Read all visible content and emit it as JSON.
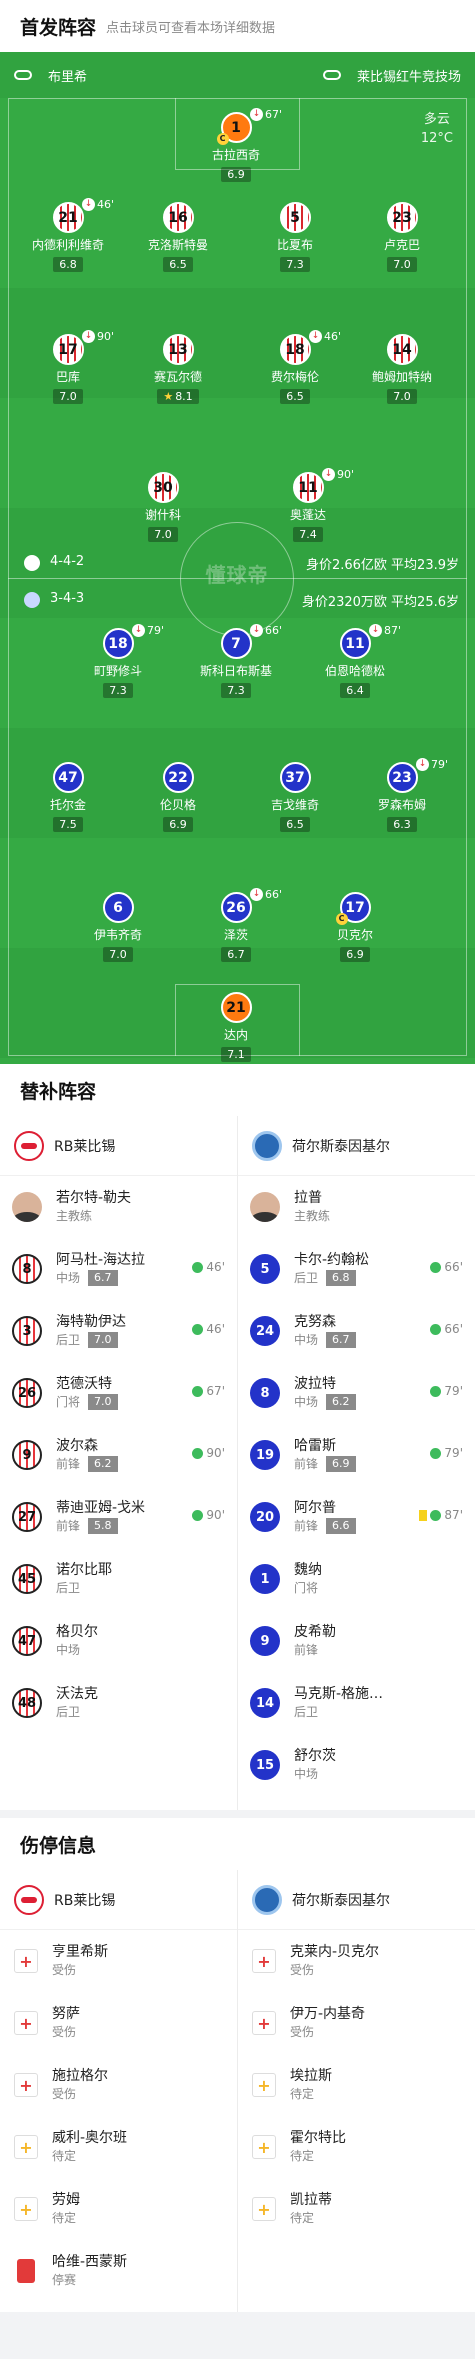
{
  "lineup_section": {
    "title": "首发阵容",
    "subtitle": "点击球员可查看本场详细数据"
  },
  "pitch": {
    "home_team": "布里希",
    "away_team": "莱比锡红牛竞技场",
    "weather": "多云",
    "temperature": "12°C",
    "watermark": "懂球帝",
    "home_formation": "4-4-2",
    "home_stats": "身价2.66亿欧  平均23.9岁",
    "away_formation": "3-4-3",
    "away_stats": "身价2320万欧  平均25.6岁"
  },
  "home_players": [
    {
      "num": "1",
      "name": "古拉西奇",
      "rating": "6.9",
      "sub": "67'",
      "captain": "C"
    },
    {
      "num": "21",
      "name": "内德利利维奇",
      "rating": "6.8",
      "sub": "46'"
    },
    {
      "num": "16",
      "name": "克洛斯特曼",
      "rating": "6.5"
    },
    {
      "num": "5",
      "name": "比夏布",
      "rating": "7.3"
    },
    {
      "num": "23",
      "name": "卢克巴",
      "rating": "7.0"
    },
    {
      "num": "17",
      "name": "巴库",
      "rating": "7.0",
      "sub": "90'"
    },
    {
      "num": "13",
      "name": "赛瓦尔德",
      "rating": "8.1"
    },
    {
      "num": "18",
      "name": "费尔梅伦",
      "rating": "6.5",
      "sub": "46'"
    },
    {
      "num": "14",
      "name": "鲍姆加特纳",
      "rating": "7.0"
    },
    {
      "num": "30",
      "name": "谢什科",
      "rating": "7.0"
    },
    {
      "num": "11",
      "name": "奥蓬达",
      "rating": "7.4",
      "sub": "90'"
    }
  ],
  "away_players": [
    {
      "num": "18",
      "name": "町野修斗",
      "rating": "7.3",
      "sub": "79'"
    },
    {
      "num": "7",
      "name": "斯科日布斯基",
      "rating": "7.3",
      "sub": "66'"
    },
    {
      "num": "11",
      "name": "伯恩哈德松",
      "rating": "6.4",
      "sub": "87'"
    },
    {
      "num": "47",
      "name": "托尔金",
      "rating": "7.5"
    },
    {
      "num": "22",
      "name": "伦贝格",
      "rating": "6.9"
    },
    {
      "num": "37",
      "name": "吉戈维奇",
      "rating": "6.5"
    },
    {
      "num": "23",
      "name": "罗森布姆",
      "rating": "6.3",
      "sub": "79'"
    },
    {
      "num": "6",
      "name": "伊韦齐奇",
      "rating": "7.0"
    },
    {
      "num": "26",
      "name": "泽茨",
      "rating": "6.7",
      "sub": "66'"
    },
    {
      "num": "17",
      "name": "贝克尔",
      "rating": "6.9",
      "captain": "C"
    },
    {
      "num": "21",
      "name": "达内",
      "rating": "7.1"
    }
  ],
  "bench_section": {
    "title": "替补阵容",
    "home_team": "RB莱比锡",
    "away_team": "荷尔斯泰因基尔",
    "home_coach": {
      "name": "若尔特-勒夫",
      "role": "主教练"
    },
    "away_coach": {
      "name": "拉普",
      "role": "主教练"
    },
    "home": [
      {
        "num": "8",
        "name": "阿马杜-海达拉",
        "pos": "中场",
        "rating": "6.7",
        "in": "46'"
      },
      {
        "num": "3",
        "name": "海特勒伊达",
        "pos": "后卫",
        "rating": "7.0",
        "in": "46'"
      },
      {
        "num": "26",
        "name": "范德沃特",
        "pos": "门将",
        "rating": "7.0",
        "in": "67'"
      },
      {
        "num": "9",
        "name": "波尔森",
        "pos": "前锋",
        "rating": "6.2",
        "in": "90'"
      },
      {
        "num": "27",
        "name": "蒂迪亚姆-戈米",
        "pos": "前锋",
        "rating": "5.8",
        "in": "90'"
      },
      {
        "num": "45",
        "name": "诺尔比耶",
        "pos": "后卫"
      },
      {
        "num": "47",
        "name": "格贝尔",
        "pos": "中场"
      },
      {
        "num": "48",
        "name": "沃法克",
        "pos": "后卫"
      }
    ],
    "away": [
      {
        "num": "5",
        "name": "卡尔-约翰松",
        "pos": "后卫",
        "rating": "6.8",
        "in": "66'"
      },
      {
        "num": "24",
        "name": "克努森",
        "pos": "中场",
        "rating": "6.7",
        "in": "66'"
      },
      {
        "num": "8",
        "name": "波拉特",
        "pos": "中场",
        "rating": "6.2",
        "in": "79'"
      },
      {
        "num": "19",
        "name": "哈雷斯",
        "pos": "前锋",
        "rating": "6.9",
        "in": "79'"
      },
      {
        "num": "20",
        "name": "阿尔普",
        "pos": "前锋",
        "rating": "6.6",
        "in": "87'",
        "card": true
      },
      {
        "num": "1",
        "name": "魏纳",
        "pos": "门将"
      },
      {
        "num": "9",
        "name": "皮希勒",
        "pos": "前锋"
      },
      {
        "num": "14",
        "name": "马克斯-格施…",
        "pos": "后卫"
      },
      {
        "num": "15",
        "name": "舒尔茨",
        "pos": "中场"
      }
    ]
  },
  "injury_section": {
    "title": "伤停信息",
    "home_team": "RB莱比锡",
    "away_team": "荷尔斯泰因基尔",
    "home": [
      {
        "name": "亨里希斯",
        "status": "受伤",
        "icon": "injury-red"
      },
      {
        "name": "努萨",
        "status": "受伤",
        "icon": "injury-red"
      },
      {
        "name": "施拉格尔",
        "status": "受伤",
        "icon": "injury-red"
      },
      {
        "name": "威利-奥尔班",
        "status": "待定",
        "icon": "injury-yellow"
      },
      {
        "name": "劳姆",
        "status": "待定",
        "icon": "injury-yellow"
      },
      {
        "name": "哈维-西蒙斯",
        "status": "停赛",
        "icon": "red-card"
      }
    ],
    "away": [
      {
        "name": "克莱内-贝克尔",
        "status": "受伤",
        "icon": "injury-red"
      },
      {
        "name": "伊万-内基奇",
        "status": "受伤",
        "icon": "injury-red"
      },
      {
        "name": "埃拉斯",
        "status": "待定",
        "icon": "injury-yellow"
      },
      {
        "name": "霍尔特比",
        "status": "待定",
        "icon": "injury-yellow"
      },
      {
        "name": "凯拉蒂",
        "status": "待定",
        "icon": "injury-yellow"
      }
    ]
  }
}
